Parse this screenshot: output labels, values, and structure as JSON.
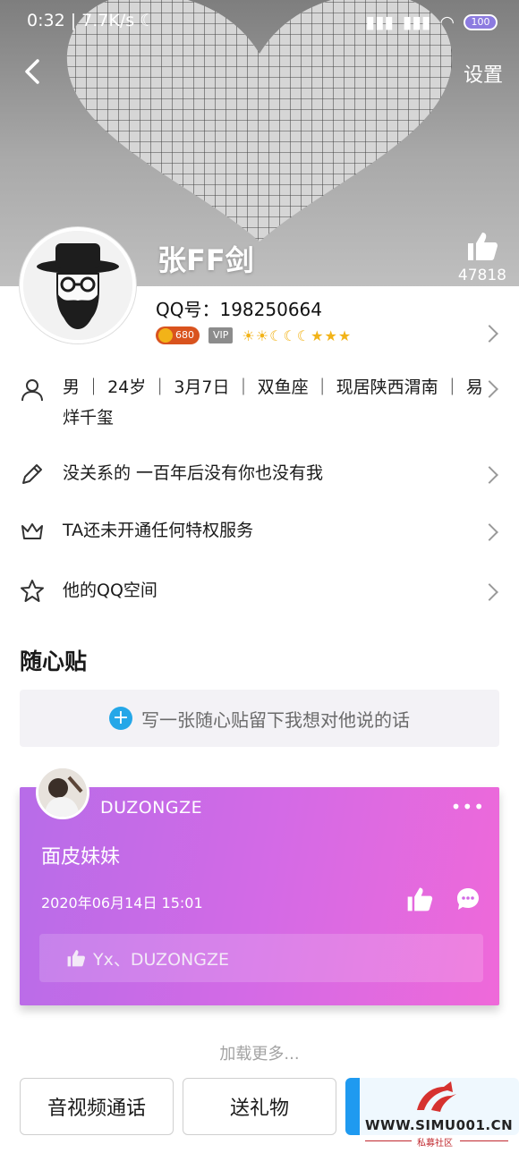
{
  "status_bar": {
    "time": "0:32",
    "speed": "7.7K/s",
    "battery": "100"
  },
  "header": {
    "settings_label": "设置",
    "name": "张FF剑",
    "like_count": "47818"
  },
  "profile": {
    "qq_label": "QQ号：198250664",
    "coin_value": "680",
    "vip_label": "VIP",
    "level_icons": "☀☀☾☾☾★★★"
  },
  "info_rows": [
    {
      "icon": "person-icon",
      "text": "男 ｜ 24岁 ｜ 3月7日 ｜ 双鱼座 ｜ 现居陕西渭南 ｜ 易烊千玺"
    },
    {
      "icon": "pencil-icon",
      "text": "没关系的 一百年后没有你也没有我"
    },
    {
      "icon": "crown-icon",
      "text": "TA还未开通任何特权服务"
    },
    {
      "icon": "star-icon",
      "text": "他的QQ空间"
    }
  ],
  "section": {
    "title": "随心贴",
    "post_placeholder": "写一张随心贴留下我想对他说的话"
  },
  "note_card": {
    "user": "DUZONGZE",
    "more": "•••",
    "message": "面皮妹妹",
    "date": "2020年06月14日  15:01",
    "likers": "Yx、DUZONGZE"
  },
  "load_more": "加载更多...",
  "bottom_bar": {
    "call_label": "音视频通话",
    "gift_label": "送礼物"
  },
  "watermark": {
    "site": "WWW.SIMU001.CN",
    "subtitle": "私募社区"
  }
}
